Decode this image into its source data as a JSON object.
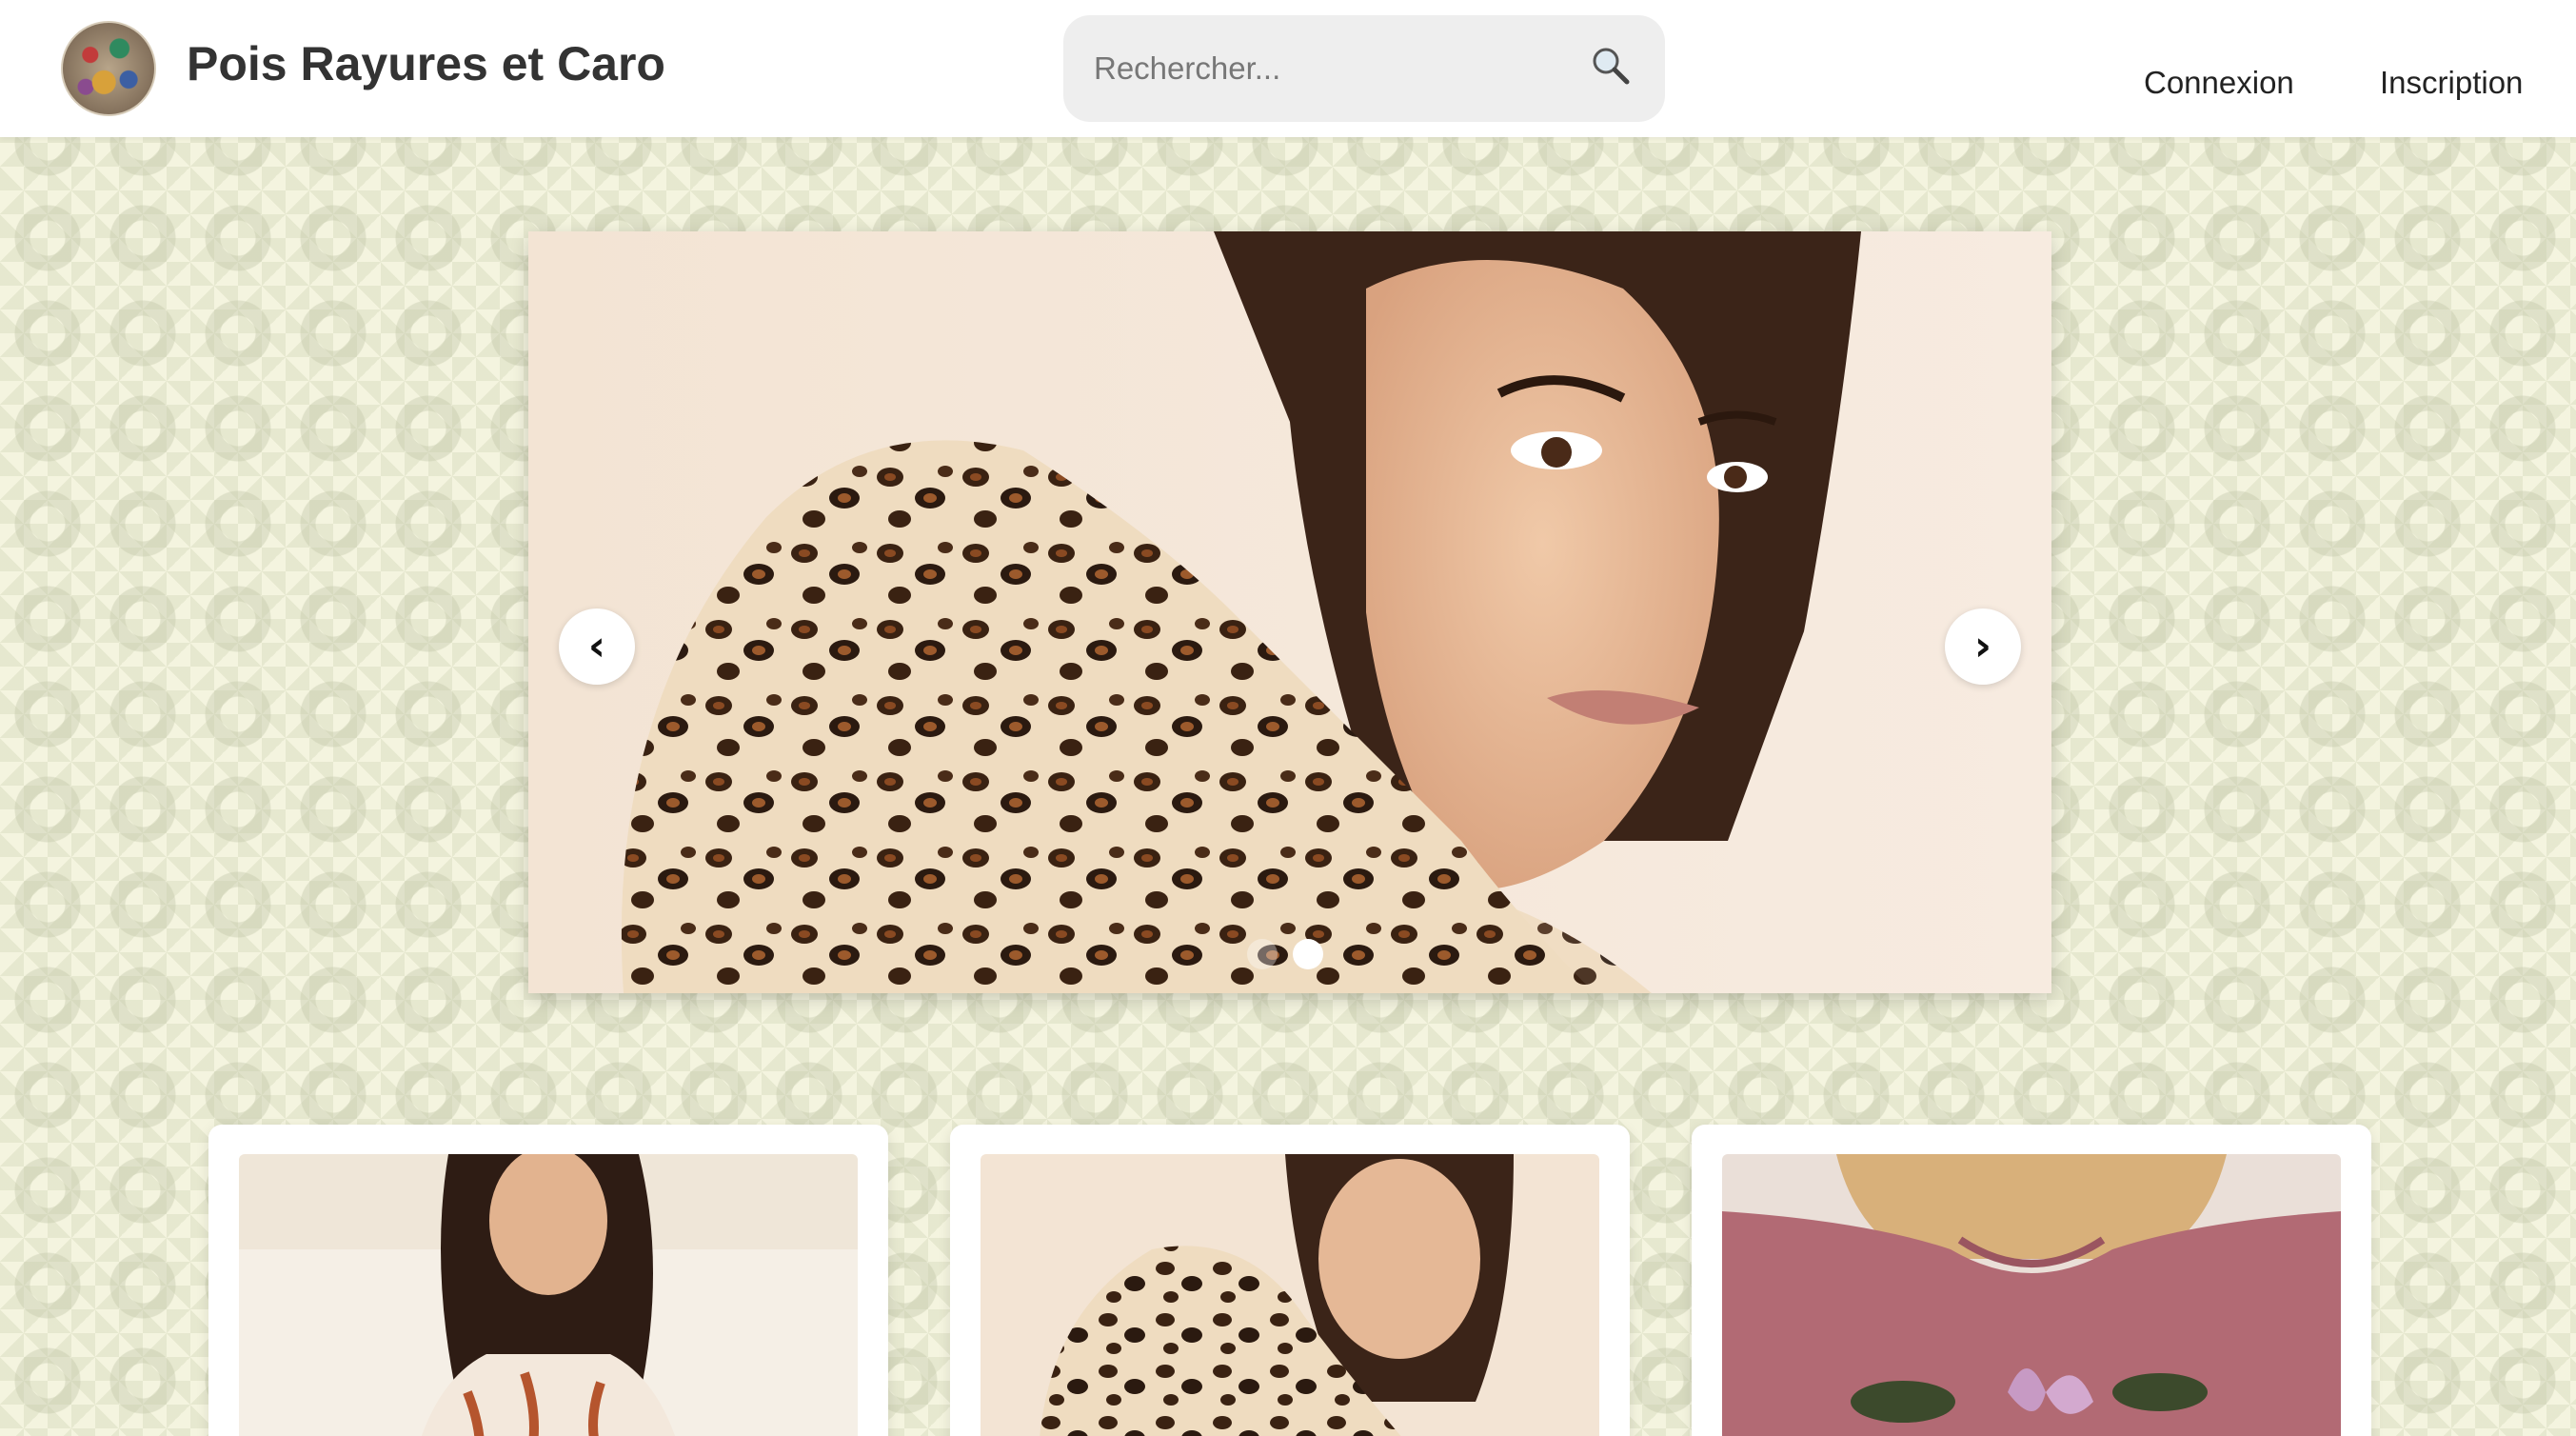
{
  "header": {
    "site_title": "Pois Rayures et Caro",
    "search_placeholder": "Rechercher...",
    "nav": {
      "login": "Connexion",
      "signup": "Inscription"
    }
  },
  "carousel": {
    "prev_label": "‹",
    "next_label": "›",
    "slide_count": 2,
    "active_slide": 2
  },
  "products": [
    {
      "image": "woman-floral-blouse-photo"
    },
    {
      "image": "woman-leopard-fur-hood-photo"
    },
    {
      "image": "pink-floral-tshirt-photo"
    }
  ],
  "colors": {
    "header_bg": "#ffffff",
    "page_bg": "#f4f4df",
    "title_text": "#333333"
  }
}
